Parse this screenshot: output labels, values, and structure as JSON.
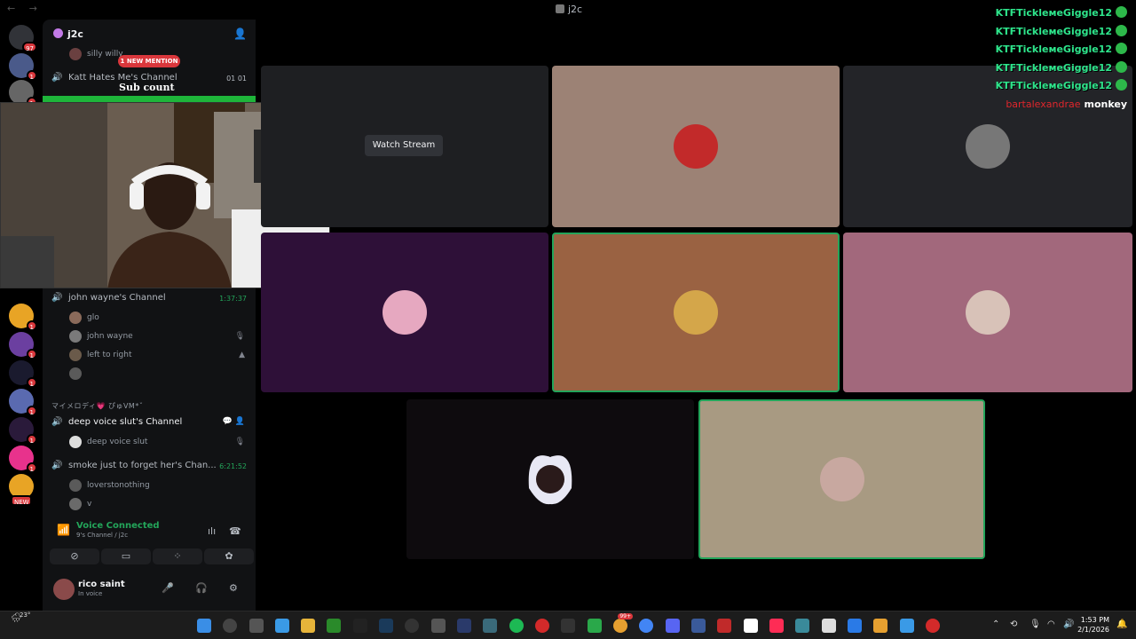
{
  "window": {
    "title": "j2c"
  },
  "guild": {
    "name": "j2c"
  },
  "overlay": {
    "mention": "1 NEW MENTION",
    "sub_count": "Sub count"
  },
  "channels": {
    "silly": {
      "member": "silly willy"
    },
    "katt": {
      "name": "Katt Hates Me's Channel",
      "counter": "01  01"
    },
    "john": {
      "name": "john wayne's Channel",
      "time": "1:37:37",
      "members": [
        "glo",
        "john wayne",
        "left to right"
      ]
    },
    "category": "マイメロディ💗 ぴゅVM*ˇ",
    "deep": {
      "name": "deep voice slut's Channel",
      "member": "deep voice slut"
    },
    "smoke": {
      "name": "smoke just to forget her's Chan...",
      "time": "6:21:52",
      "members": [
        "loverstonothing",
        "v"
      ]
    }
  },
  "voice_panel": {
    "status": "Voice Connected",
    "channel": "9's Channel / j2c"
  },
  "user": {
    "name": "rico saint",
    "status": "In voice"
  },
  "stage": {
    "watch_label": "Watch Stream"
  },
  "chat": {
    "lines": [
      "KTFTickleмeGiggle12",
      "KTFTickleмeGiggle12",
      "KTFTickleмeGiggle12",
      "KTFTickleмeGiggle12",
      "KTFTickleмeGiggle12"
    ],
    "last_user": "bartalexandrae",
    "last_msg": "monkey"
  },
  "server_badges": [
    "97",
    "1",
    "1",
    "1",
    "1",
    "1",
    "1",
    "1",
    "1",
    "1",
    "NEW"
  ],
  "taskbar": {
    "weather": "23°",
    "time": "1:53 PM",
    "date": "2/1/2026",
    "badge": "99+"
  },
  "colors": {
    "green": "#23a55a",
    "accent_red": "#da373c",
    "chat_green": "#2ee68c"
  }
}
